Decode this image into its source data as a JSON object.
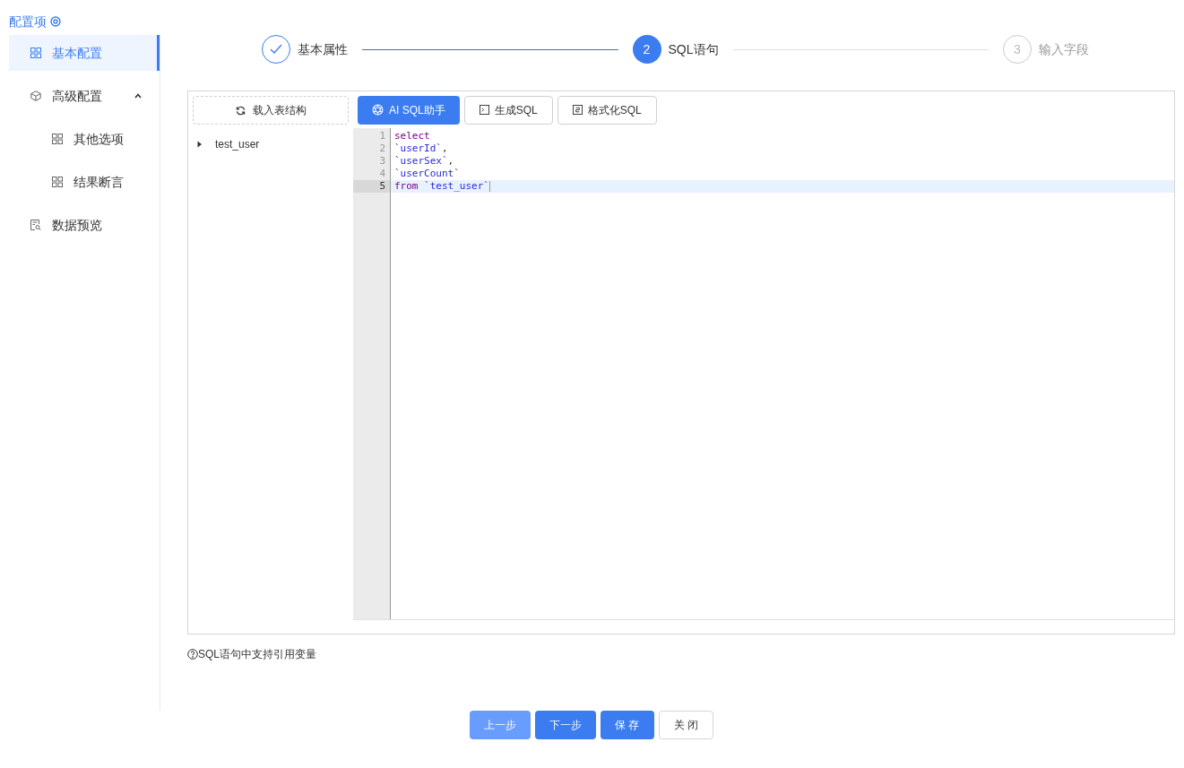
{
  "sidebar": {
    "title": "配置项",
    "items": [
      {
        "label": "基本配置",
        "kind": "grid",
        "selected": true
      },
      {
        "label": "高级配置",
        "kind": "cube",
        "selected": false,
        "expanded": true,
        "children": [
          {
            "label": "其他选项",
            "kind": "grid",
            "selected": false
          },
          {
            "label": "结果断言",
            "kind": "grid",
            "selected": false
          }
        ]
      },
      {
        "label": "数据预览",
        "kind": "preview",
        "selected": false
      }
    ]
  },
  "steps": [
    {
      "label": "基本属性",
      "done": true,
      "selected": false
    },
    {
      "number": "2",
      "label": "SQL语句",
      "done": false,
      "selected": true
    },
    {
      "number": "3",
      "label": "输入字段",
      "done": false,
      "selected": false
    }
  ],
  "table_panel": {
    "load_button": "载入表结构",
    "tree": [
      {
        "label": "test_user",
        "expanded": false
      }
    ]
  },
  "toolbar": [
    {
      "label": "AI SQL助手",
      "kind": "ai"
    },
    {
      "label": "生成SQL",
      "kind": "terminal"
    },
    {
      "label": "格式化SQL",
      "kind": "format"
    }
  ],
  "editor": {
    "lines": [
      {
        "number": "1",
        "selected": false,
        "tokens": [
          {
            "text": "select",
            "kind": "keyword"
          }
        ]
      },
      {
        "number": "2",
        "selected": false,
        "tokens": [
          {
            "text": "`userId`",
            "kind": "identifier"
          },
          {
            "text": ",",
            "kind": "plain"
          }
        ]
      },
      {
        "number": "3",
        "selected": false,
        "tokens": [
          {
            "text": "`userSex`",
            "kind": "identifier"
          },
          {
            "text": ",",
            "kind": "plain"
          }
        ]
      },
      {
        "number": "4",
        "selected": false,
        "tokens": [
          {
            "text": "`userCount`",
            "kind": "identifier"
          }
        ]
      },
      {
        "number": "5",
        "selected": true,
        "tokens": [
          {
            "text": "from",
            "kind": "keyword"
          },
          {
            "text": "`test_user`",
            "kind": "identifier",
            "space_before": true
          }
        ]
      }
    ]
  },
  "hint": "SQL语句中支持引用变量",
  "footer_buttons": [
    {
      "label": "上一步",
      "kind": "primary",
      "disabled": true
    },
    {
      "label": "下一步",
      "kind": "primary",
      "disabled": false
    },
    {
      "label": "保 存",
      "kind": "primary",
      "disabled": false
    },
    {
      "label": "关 闭",
      "kind": "default",
      "disabled": false
    }
  ]
}
